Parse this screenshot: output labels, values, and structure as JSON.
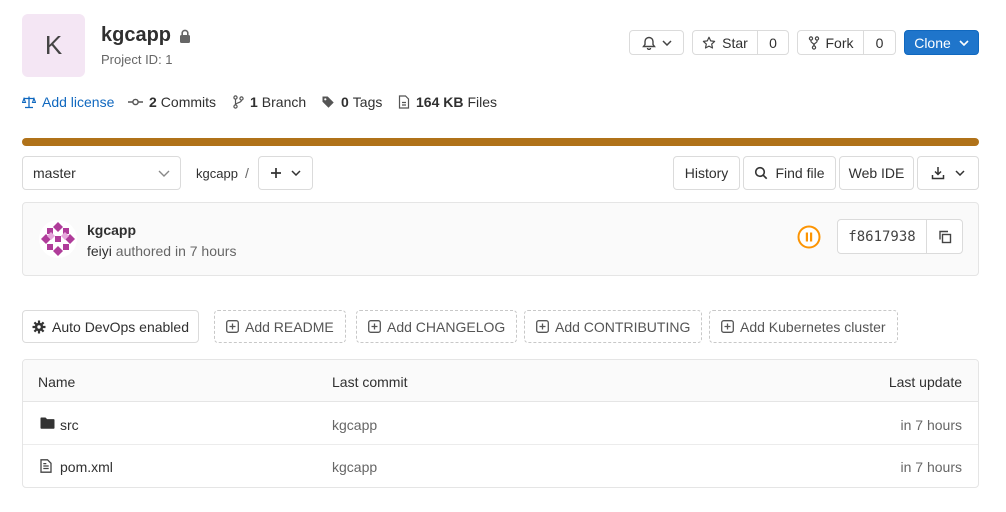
{
  "project": {
    "avatar_letter": "K",
    "name": "kgcapp",
    "id_text": "Project ID: 1"
  },
  "header_actions": {
    "star_label": "Star",
    "star_count": "0",
    "fork_label": "Fork",
    "fork_count": "0",
    "clone_label": "Clone"
  },
  "stats": {
    "add_license": "Add license",
    "commits_count": "2",
    "commits_label": "Commits",
    "branch_count": "1",
    "branch_label": "Branch",
    "tags_count": "0",
    "tags_label": "Tags",
    "files_size": "164 KB",
    "files_label": "Files"
  },
  "language_bar": {
    "fraction": 1.0,
    "color": "#b07219"
  },
  "toolbar": {
    "branch": "master",
    "path_root": "kgcapp",
    "path_sep": "/",
    "history": "History",
    "find_file": "Find file",
    "web_ide": "Web IDE"
  },
  "commit": {
    "title": "kgcapp",
    "author": "feiyi",
    "authored_text": "authored in 7 hours",
    "sha": "f8617938",
    "pipeline_color": "#fc9403"
  },
  "quick_actions": {
    "auto_devops": "Auto DevOps enabled",
    "add_readme": "Add README",
    "add_changelog": "Add CHANGELOG",
    "add_contributing": "Add CONTRIBUTING",
    "add_k8s": "Add Kubernetes cluster"
  },
  "file_table": {
    "headers": {
      "name": "Name",
      "last_commit": "Last commit",
      "last_update": "Last update"
    },
    "rows": [
      {
        "icon": "folder-icon",
        "name": "src",
        "commit": "kgcapp",
        "updated": "in 7 hours"
      },
      {
        "icon": "file-icon",
        "name": "pom.xml",
        "commit": "kgcapp",
        "updated": "in 7 hours"
      }
    ]
  },
  "colors": {
    "primary": "#1f75cb",
    "link": "#1068bf",
    "avatar_bg": "#f4e6f4"
  }
}
